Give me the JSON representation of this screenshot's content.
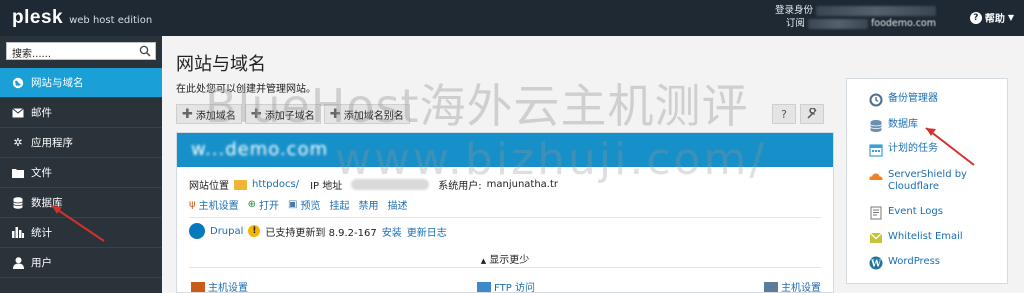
{
  "topbar": {
    "logo": "plesk",
    "edition": "web host edition",
    "identity_label": "登录身份",
    "subscription_label": "订阅",
    "subscription_value": "foodemo.com",
    "help_label": "帮助"
  },
  "sidebar": {
    "search_placeholder": "搜索......",
    "items": [
      {
        "label": "网站与域名",
        "icon": "globe-icon"
      },
      {
        "label": "邮件",
        "icon": "mail-icon"
      },
      {
        "label": "应用程序",
        "icon": "gear-icon"
      },
      {
        "label": "文件",
        "icon": "folder-icon"
      },
      {
        "label": "数据库",
        "icon": "database-icon"
      },
      {
        "label": "统计",
        "icon": "bar-chart-icon"
      },
      {
        "label": "用户",
        "icon": "user-icon"
      }
    ]
  },
  "main": {
    "title": "网站与域名",
    "description": "在此处您可以创建并管理网站。",
    "toolbar": {
      "add_domain": "添加域名",
      "add_subdomain": "添加子域名",
      "add_alias": "添加域名别名"
    },
    "domain": {
      "name": "w...demo.com",
      "site_location_label": "网站位置",
      "site_location_value": "httpdocs/",
      "ip_label": "IP 地址",
      "system_user_label": "系统用户:",
      "system_user_value": "manjunatha.tr",
      "actions": [
        "主机设置",
        "打开",
        "预览",
        "挂起",
        "禁用",
        "描述"
      ],
      "app_name": "Drupal",
      "app_status": "已支持更新到 8.9.2-167",
      "app_install": "安装",
      "app_changelog": "更新日志",
      "show_less": "显示更少",
      "bottom_links": [
        "主机设置",
        "FTP 访问",
        "主机设置"
      ]
    }
  },
  "right_panel": {
    "items": [
      {
        "label": "备份管理器",
        "icon": "backup-icon",
        "color": "#4a6f8f"
      },
      {
        "label": "数据库",
        "icon": "database-icon",
        "color": "#6a8fb3"
      },
      {
        "label": "计划的任务",
        "icon": "calendar-icon",
        "color": "#3aa0d8"
      },
      {
        "label": "ServerShield by Cloudflare",
        "icon": "cloudflare-icon",
        "color": "#f38020"
      },
      {
        "label": "Event Logs",
        "icon": "log-icon",
        "color": "#777777"
      },
      {
        "label": "Whitelist Email",
        "icon": "whitelist-icon",
        "color": "#c8c43a"
      },
      {
        "label": "WordPress",
        "icon": "wordpress-icon",
        "color": "#21759b"
      }
    ]
  },
  "watermark": {
    "line1": "BlueHost海外云主机测评",
    "line2": "www.bizhuji.com/"
  },
  "colors": {
    "topbar": "#1f2933",
    "sidebar": "#2a323a",
    "active": "#1aa0d6",
    "domain_header": "#1790c9",
    "link": "#1a6eb5",
    "annotation": "#d32f2f"
  }
}
